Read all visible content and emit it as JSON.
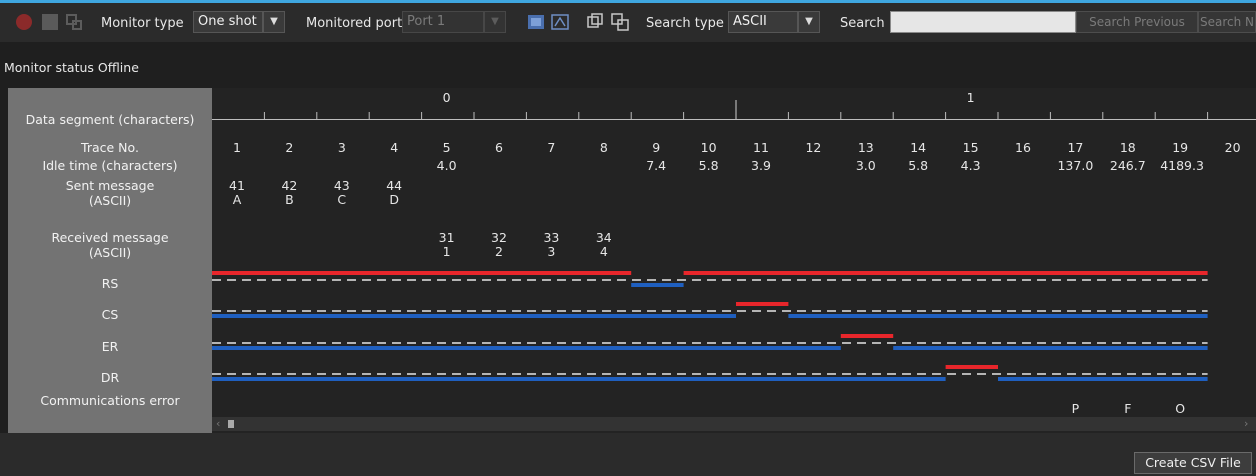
{
  "toolbar": {
    "monitor_type_label": "Monitor type",
    "monitor_type_value": "One shot",
    "monitored_port_label": "Monitored port",
    "monitored_port_value": "Port 1",
    "search_type_label": "Search type",
    "search_type_value": "ASCII",
    "search_label": "Search",
    "search_value": "",
    "search_previous": "Search Previous",
    "search_next": "Search N"
  },
  "status": {
    "text": "Monitor status Offline"
  },
  "rows": {
    "data_segment": "Data segment (characters)",
    "trace_no": "Trace No.",
    "idle_time": "Idle time (characters)",
    "sent_message": "Sent message",
    "sent_message_sub": "(ASCII)",
    "received_message": "Received message",
    "received_message_sub": "(ASCII)",
    "rs": "RS",
    "cs": "CS",
    "er": "ER",
    "dr": "DR",
    "comm_error": "Communications error"
  },
  "segments": [
    {
      "label": "0",
      "trace": 5
    },
    {
      "label": "1",
      "trace": 15
    }
  ],
  "traces": [
    {
      "no": "1",
      "idle": "",
      "sent_hex": "41",
      "sent_char": "A",
      "recv_hex": "",
      "recv_char": "",
      "error": ""
    },
    {
      "no": "2",
      "idle": "",
      "sent_hex": "42",
      "sent_char": "B",
      "recv_hex": "",
      "recv_char": "",
      "error": ""
    },
    {
      "no": "3",
      "idle": "",
      "sent_hex": "43",
      "sent_char": "C",
      "recv_hex": "",
      "recv_char": "",
      "error": ""
    },
    {
      "no": "4",
      "idle": "",
      "sent_hex": "44",
      "sent_char": "D",
      "recv_hex": "",
      "recv_char": "",
      "error": ""
    },
    {
      "no": "5",
      "idle": "4.0",
      "sent_hex": "",
      "sent_char": "",
      "recv_hex": "31",
      "recv_char": "1",
      "error": ""
    },
    {
      "no": "6",
      "idle": "",
      "sent_hex": "",
      "sent_char": "",
      "recv_hex": "32",
      "recv_char": "2",
      "error": ""
    },
    {
      "no": "7",
      "idle": "",
      "sent_hex": "",
      "sent_char": "",
      "recv_hex": "33",
      "recv_char": "3",
      "error": ""
    },
    {
      "no": "8",
      "idle": "",
      "sent_hex": "",
      "sent_char": "",
      "recv_hex": "34",
      "recv_char": "4",
      "error": ""
    },
    {
      "no": "9",
      "idle": "7.4",
      "sent_hex": "",
      "sent_char": "",
      "recv_hex": "",
      "recv_char": "",
      "error": ""
    },
    {
      "no": "10",
      "idle": "5.8",
      "sent_hex": "",
      "sent_char": "",
      "recv_hex": "",
      "recv_char": "",
      "error": ""
    },
    {
      "no": "11",
      "idle": "3.9",
      "sent_hex": "",
      "sent_char": "",
      "recv_hex": "",
      "recv_char": "",
      "error": ""
    },
    {
      "no": "12",
      "idle": "",
      "sent_hex": "",
      "sent_char": "",
      "recv_hex": "",
      "recv_char": "",
      "error": ""
    },
    {
      "no": "13",
      "idle": "3.0",
      "sent_hex": "",
      "sent_char": "",
      "recv_hex": "",
      "recv_char": "",
      "error": ""
    },
    {
      "no": "14",
      "idle": "5.8",
      "sent_hex": "",
      "sent_char": "",
      "recv_hex": "",
      "recv_char": "",
      "error": ""
    },
    {
      "no": "15",
      "idle": "4.3",
      "sent_hex": "",
      "sent_char": "",
      "recv_hex": "",
      "recv_char": "",
      "error": ""
    },
    {
      "no": "16",
      "idle": "",
      "sent_hex": "",
      "sent_char": "",
      "recv_hex": "",
      "recv_char": "",
      "error": ""
    },
    {
      "no": "17",
      "idle": "137.0",
      "sent_hex": "",
      "sent_char": "",
      "recv_hex": "",
      "recv_char": "",
      "error": "P"
    },
    {
      "no": "18",
      "idle": "246.7",
      "sent_hex": "",
      "sent_char": "",
      "recv_hex": "",
      "recv_char": "",
      "error": "F"
    },
    {
      "no": "19",
      "idle": "4189.3",
      "sent_hex": "",
      "sent_char": "",
      "recv_hex": "",
      "recv_char": "",
      "error": "O"
    },
    {
      "no": "20",
      "idle": "",
      "sent_hex": "",
      "sent_char": "",
      "recv_hex": "",
      "recv_char": "",
      "error": ""
    }
  ],
  "signals": {
    "RS": [
      {
        "from": 0,
        "to": 8,
        "on": true
      },
      {
        "from": 8,
        "to": 9,
        "on": false
      },
      {
        "from": 9,
        "to": 19,
        "on": true
      }
    ],
    "CS": [
      {
        "from": 0,
        "to": 10,
        "on": false
      },
      {
        "from": 10,
        "to": 11,
        "on": true
      },
      {
        "from": 11,
        "to": 19,
        "on": false
      }
    ],
    "ER": [
      {
        "from": 0,
        "to": 12,
        "on": false
      },
      {
        "from": 12,
        "to": 13,
        "on": true
      },
      {
        "from": 13,
        "to": 19,
        "on": false
      }
    ],
    "DR": [
      {
        "from": 0,
        "to": 14,
        "on": false
      },
      {
        "from": 14,
        "to": 15,
        "on": true
      },
      {
        "from": 15,
        "to": 19,
        "on": false
      }
    ]
  },
  "colors": {
    "on": "#e8262b",
    "off": "#1f5fbf",
    "dash": "#e6e6e6"
  },
  "bottom": {
    "create_csv": "Create CSV File"
  }
}
